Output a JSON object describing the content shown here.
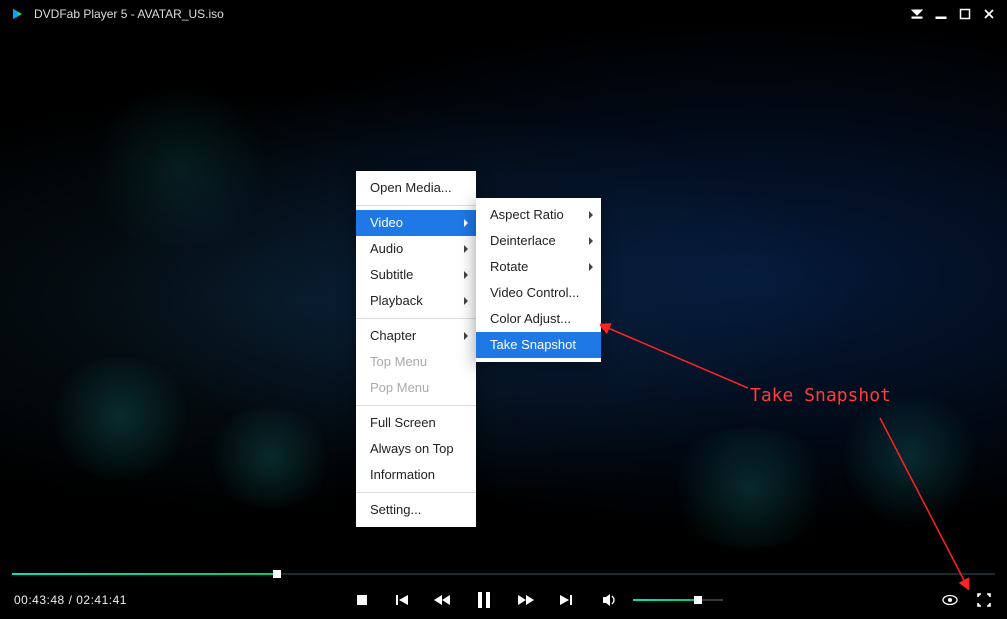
{
  "title": "DVDFab Player 5 - AVATAR_US.iso",
  "context_menu": {
    "items": [
      {
        "label": "Open Media...",
        "has_sub": false
      },
      null,
      {
        "label": "Video",
        "has_sub": true,
        "highlight": true
      },
      {
        "label": "Audio",
        "has_sub": true
      },
      {
        "label": "Subtitle",
        "has_sub": true
      },
      {
        "label": "Playback",
        "has_sub": true
      },
      null,
      {
        "label": "Chapter",
        "has_sub": true
      },
      {
        "label": "Top Menu",
        "disabled": true
      },
      {
        "label": "Pop Menu",
        "disabled": true
      },
      null,
      {
        "label": "Full Screen"
      },
      {
        "label": "Always on Top"
      },
      {
        "label": "Information"
      },
      null,
      {
        "label": "Setting..."
      }
    ]
  },
  "video_submenu": {
    "items": [
      {
        "label": "Aspect Ratio",
        "has_sub": true
      },
      {
        "label": "Deinterlace",
        "has_sub": true
      },
      {
        "label": "Rotate",
        "has_sub": true
      },
      {
        "label": "Video Control..."
      },
      {
        "label": "Color Adjust..."
      },
      {
        "label": "Take Snapshot",
        "highlight": true
      }
    ]
  },
  "annotation": {
    "text": "Take Snapshot"
  },
  "playback": {
    "current": "00:43:48",
    "total": "02:41:41",
    "progress_pct": 27,
    "volume_pct": 72
  }
}
